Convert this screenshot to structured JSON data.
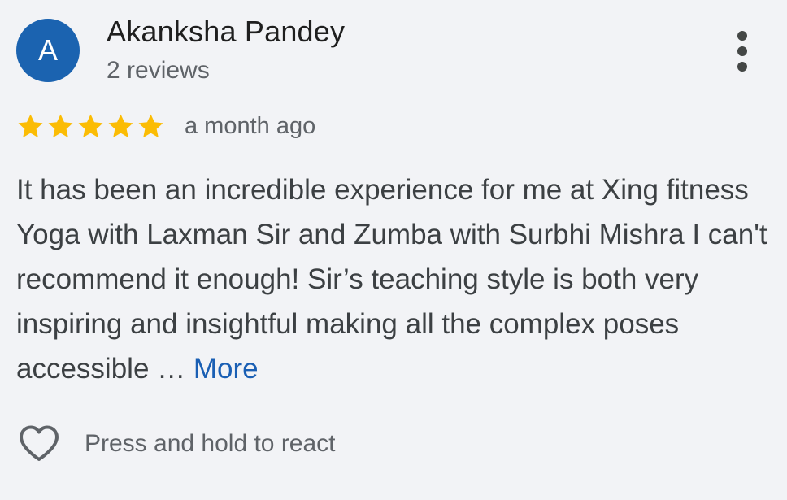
{
  "reviewer": {
    "avatar_letter": "A",
    "name": "Akanksha Pandey",
    "reviews_count": "2 reviews"
  },
  "rating": {
    "stars": 5,
    "max_stars": 5,
    "time_ago": "a month ago"
  },
  "review": {
    "text": "It has been an incredible experience for me at Xing fitness Yoga with Laxman Sir and Zumba with Surbhi Mishra I can't recommend it enough! Sir’s teaching style is both very inspiring and insightful making all the complex poses accessible …",
    "more_label": "More"
  },
  "reaction": {
    "label": "Press and hold to react"
  },
  "icons": {
    "menu": "more-vert-icon",
    "star": "star-icon",
    "heart": "heart-outline-icon"
  },
  "colors": {
    "avatar_bg": "#1b63b0",
    "star": "#fbbc04",
    "link": "#1a5fb4",
    "background": "#f2f3f6"
  }
}
